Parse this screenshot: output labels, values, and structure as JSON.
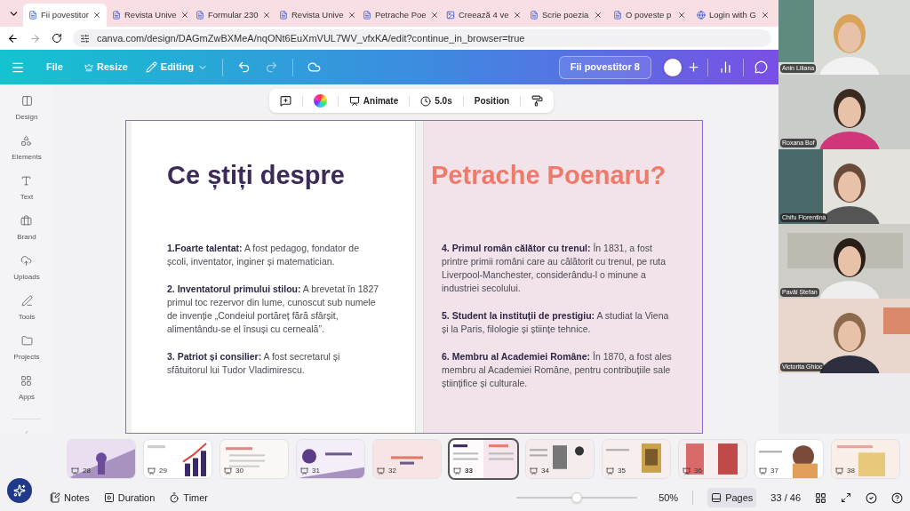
{
  "browser": {
    "tabs": [
      {
        "title": "Fii povestitor",
        "selected": true
      },
      {
        "title": "Revista Unive",
        "selected": false
      },
      {
        "title": "Formular 230",
        "selected": false
      },
      {
        "title": "Revista Unive",
        "selected": false
      },
      {
        "title": "Petrache Poe",
        "selected": false
      },
      {
        "title": "Creează 4 ve",
        "selected": false
      },
      {
        "title": "Scrie poezia",
        "selected": false
      },
      {
        "title": "O poveste p",
        "selected": false
      },
      {
        "title": "Login with G",
        "selected": false
      }
    ],
    "url": "canva.com/design/DAGmZwBXMeA/nqONt6EuXmVUL7WV_vfxKA/edit?continue_in_browser=true"
  },
  "toolbar": {
    "file": "File",
    "resize": "Resize",
    "editing": "Editing",
    "design_title": "Fii povestitor 8"
  },
  "element_toolbar": {
    "animate": "Animate",
    "duration": "5.0s",
    "position": "Position"
  },
  "sidebar": {
    "items": [
      {
        "label": "Design"
      },
      {
        "label": "Elements"
      },
      {
        "label": "Text"
      },
      {
        "label": "Brand"
      },
      {
        "label": "Uploads"
      },
      {
        "label": "Tools"
      },
      {
        "label": "Projects"
      },
      {
        "label": "Apps"
      }
    ]
  },
  "slide": {
    "title_left": "Ce știți despre",
    "title_right": "Petrache Poenaru?",
    "left_items": [
      "**1.Foarte talentat:** A fost pedagog, fondator de școli, inventator, inginer și matematician.",
      "**2. Inventatorul primului stilou:** A brevetat în 1827 primul toc rezervor din lume, cunoscut sub numele de invenție „Condeiul portăreț fără sfârșit, alimentându-se el însuși cu cerneală”.",
      "**3. Patriot și consilier:** A fost secretarul și sfătuitorul lui Tudor Vladimirescu."
    ],
    "right_items": [
      "**4. Primul român călător cu trenul:** În 1831, a fost printre primii români care au călătorit cu trenul, pe ruta Liverpool-Manchester, considerându-l o minune a industriei secolului.",
      "**5. Student la instituții de prestigiu:** A studiat la Viena și la Paris, filologie și științe tehnice.",
      "**6. Membru al Academiei Române:** În 1870, a fost ales membru al Academiei Române, pentru contribuțiile sale științifice și culturale."
    ]
  },
  "pages": [
    {
      "number": "28",
      "selected": false
    },
    {
      "number": "29",
      "selected": false
    },
    {
      "number": "30",
      "selected": false
    },
    {
      "number": "31",
      "selected": false
    },
    {
      "number": "32",
      "selected": false
    },
    {
      "number": "33",
      "selected": true
    },
    {
      "number": "34",
      "selected": false
    },
    {
      "number": "35",
      "selected": false
    },
    {
      "number": "36",
      "selected": false
    },
    {
      "number": "37",
      "selected": false
    },
    {
      "number": "38",
      "selected": false
    }
  ],
  "bottom_bar": {
    "notes": "Notes",
    "duration": "Duration",
    "timer": "Timer",
    "zoom": {
      "level": 0.5,
      "reading": "50%"
    },
    "pages": "Pages",
    "page_count": "33 / 46"
  },
  "participants": [
    {
      "name": "Anin Liliana"
    },
    {
      "name": "Roxana Bof"
    },
    {
      "name": "Chifu Florentina"
    },
    {
      "name": "Pavăl Ștefan"
    },
    {
      "name": "Victorita Ghioc"
    }
  ]
}
